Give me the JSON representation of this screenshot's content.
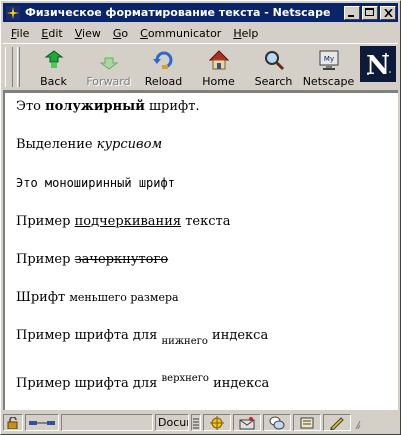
{
  "window": {
    "title": "Физическое форматирование текста - Netscape"
  },
  "menu": {
    "items": [
      {
        "label": "File",
        "key": "F"
      },
      {
        "label": "Edit",
        "key": "E"
      },
      {
        "label": "View",
        "key": "V"
      },
      {
        "label": "Go",
        "key": "G"
      },
      {
        "label": "Communicator",
        "key": "C"
      },
      {
        "label": "Help",
        "key": "H"
      }
    ]
  },
  "toolbar": {
    "back": "Back",
    "forward": "Forward",
    "reload": "Reload",
    "home": "Home",
    "search": "Search",
    "netscape": "Netscape",
    "netscape_icon_text": "My",
    "logo_letter": "N"
  },
  "content": {
    "line1": {
      "before": "Это ",
      "bold": "полужирный",
      "after": " шрифт."
    },
    "line2": {
      "before": "Выделение ",
      "italic": "курсивом"
    },
    "line3": {
      "mono": "Это моноширинный шрифт"
    },
    "line4": {
      "before": "Пример ",
      "underline": "подчеркивания",
      "after": " текста"
    },
    "line5": {
      "before": "Пример ",
      "strike": "зачеркнутого"
    },
    "line6": {
      "before": "Шрифт ",
      "small": "меньшего размера"
    },
    "line7": {
      "before": "Пример шрифта для ",
      "sub": "нижнего",
      "after": " индекса"
    },
    "line8": {
      "before": "Пример шрифта для ",
      "sup": "верхнего",
      "after": " индекса"
    }
  },
  "status": {
    "document_text": "Docun"
  },
  "colors": {
    "titlebar": "#0a246a",
    "chrome": "#d4d0c8"
  }
}
